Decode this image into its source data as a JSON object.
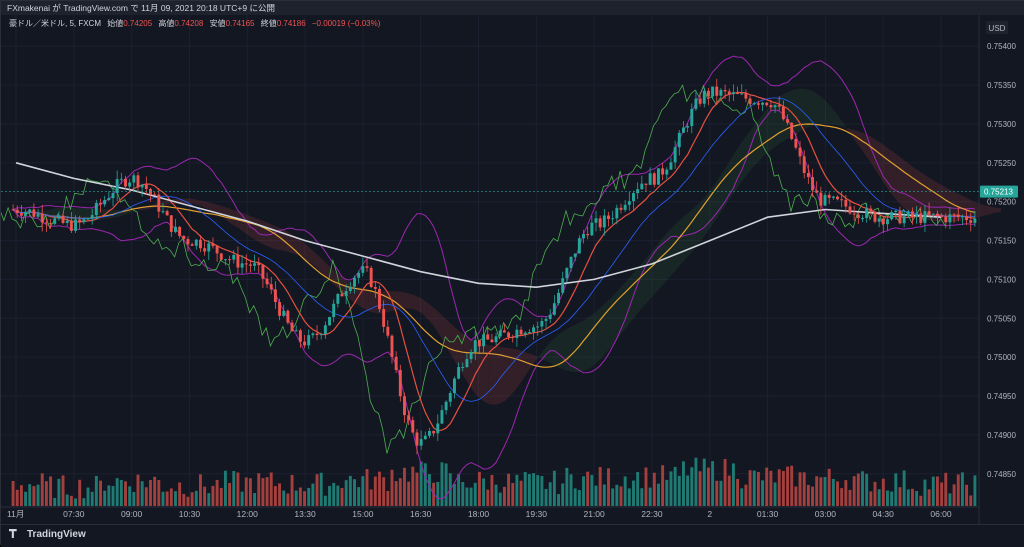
{
  "header": {
    "published_text": "FXmakenai が TradingView.com で 11月 09, 2021 20:18 UTC+9 に公開"
  },
  "legend": {
    "symbol": "豪ドル／米ドル, 5, FXCM",
    "open_label": "始値",
    "open_value": "0.74205",
    "high_label": "高値",
    "high_value": "0.74208",
    "low_label": "安値",
    "low_value": "0.74165",
    "close_label": "終値",
    "close_value": "0.74186",
    "change": "−0.00019 (−0.03%)"
  },
  "footer": {
    "brand": "TradingView"
  },
  "colors": {
    "background": "#131722",
    "up": "#26a69a",
    "down": "#ef5350",
    "volume_up": "#1f7a73",
    "volume_down": "#a33f3d",
    "bollinger": "#9c27b0",
    "ma_long": "#d1d4dc",
    "ma_mid": "#e0a030",
    "ma_short": "#e65040",
    "chikou": "#4caf50",
    "last_price_bg": "#26a69a"
  },
  "chart_data": {
    "type": "candlestick",
    "symbol": "豪ドル／米ドル",
    "timeframe": "5",
    "currency": "USD",
    "last_price": "0.75213",
    "y_ticks": [
      "0.75400",
      "0.75350",
      "0.75300",
      "0.75250",
      "0.75200",
      "0.75150",
      "0.75100",
      "0.75050",
      "0.75000",
      "0.74950",
      "0.74900",
      "0.74850"
    ],
    "ylim": [
      0.74815,
      0.75435
    ],
    "x_ticks": [
      "11月",
      "07:30",
      "09:00",
      "10:30",
      "12:00",
      "13:30",
      "15:00",
      "16:30",
      "18:00",
      "19:30",
      "21:00",
      "22:30",
      "2",
      "01:30",
      "03:00",
      "04:30",
      "06:00"
    ],
    "price_path_keypoints": [
      {
        "x": "11月",
        "y": 0.7519
      },
      {
        "x": "07:30",
        "y": 0.7517
      },
      {
        "x": "09:00",
        "y": 0.7523
      },
      {
        "x": "10:30",
        "y": 0.7515
      },
      {
        "x": "12:00",
        "y": 0.7512
      },
      {
        "x": "13:30",
        "y": 0.7502
      },
      {
        "x": "15:00",
        "y": 0.7511
      },
      {
        "x": "16:30",
        "y": 0.7489
      },
      {
        "x": "18:00",
        "y": 0.7502
      },
      {
        "x": "19:30",
        "y": 0.7504
      },
      {
        "x": "21:00",
        "y": 0.7517
      },
      {
        "x": "22:30",
        "y": 0.7523
      },
      {
        "x": "2",
        "y": 0.7534
      },
      {
        "x": "01:30",
        "y": 0.7533
      },
      {
        "x": "03:00",
        "y": 0.752
      },
      {
        "x": "04:30",
        "y": 0.7518
      },
      {
        "x": "06:00",
        "y": 0.7518
      }
    ],
    "moving_average_long": [
      0.7525,
      0.7523,
      0.75215,
      0.75195,
      0.75175,
      0.7515,
      0.7513,
      0.7511,
      0.75095,
      0.7509,
      0.751,
      0.7512,
      0.7515,
      0.7518,
      0.7519,
      0.75185,
      0.7518
    ],
    "volume_relative": [
      0.35,
      0.25,
      0.45,
      0.3,
      0.4,
      0.35,
      0.5,
      0.75,
      0.45,
      0.4,
      0.55,
      0.6,
      0.85,
      0.6,
      0.55,
      0.45,
      0.35
    ]
  }
}
